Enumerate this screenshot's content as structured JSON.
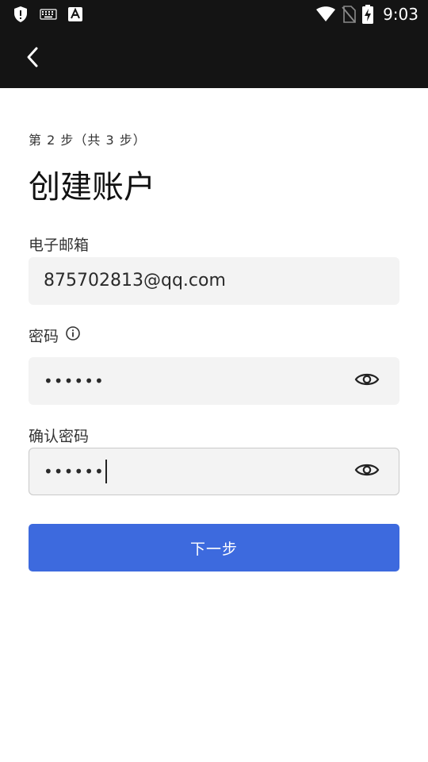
{
  "status_bar": {
    "time": "9:03",
    "icons": [
      "shield-alert-icon",
      "keyboard-icon",
      "font-a-icon",
      "wifi-icon",
      "no-sim-icon",
      "battery-charging-icon"
    ]
  },
  "header": {
    "back_icon": "chevron-left-icon"
  },
  "form": {
    "step_text": "第 2 步（共 3 步）",
    "title": "创建账户",
    "email": {
      "label": "电子邮箱",
      "value": "875702813@qq.com"
    },
    "password": {
      "label": "密码",
      "info_icon": "info-icon",
      "value": "••••••",
      "toggle_icon": "eye-icon"
    },
    "confirm_password": {
      "label": "确认密码",
      "value": "••••••",
      "toggle_icon": "eye-icon"
    },
    "next_label": "下一步"
  },
  "colors": {
    "app_bar": "#141414",
    "input_bg": "#f3f3f3",
    "primary": "#3d6ade"
  }
}
